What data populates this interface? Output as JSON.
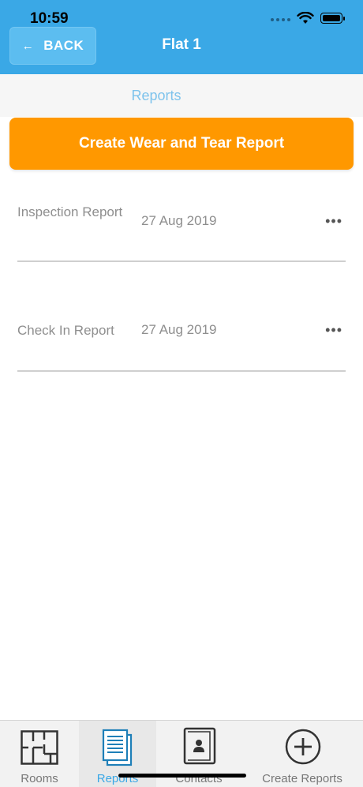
{
  "status": {
    "time": "10:59"
  },
  "header": {
    "back_label": "BACK",
    "title": "Flat 1"
  },
  "section": {
    "label": "Reports"
  },
  "actions": {
    "create_label": "Create Wear and Tear Report"
  },
  "reports": [
    {
      "name": "Inspection Report",
      "date": "27 Aug 2019",
      "more": "•••"
    },
    {
      "name": "Check In Report",
      "date": "27 Aug 2019",
      "more": "•••"
    }
  ],
  "tabs": [
    {
      "label": "Rooms",
      "icon": "floorplan-icon",
      "active": false
    },
    {
      "label": "Reports",
      "icon": "documents-icon",
      "active": true
    },
    {
      "label": "Contacts",
      "icon": "contact-book-icon",
      "active": false
    },
    {
      "label": "Create Reports",
      "icon": "plus-circle-icon",
      "active": false
    }
  ],
  "colors": {
    "header": "#3aa8e6",
    "accent": "#ff9800",
    "tab_active": "#3aa8e6"
  }
}
